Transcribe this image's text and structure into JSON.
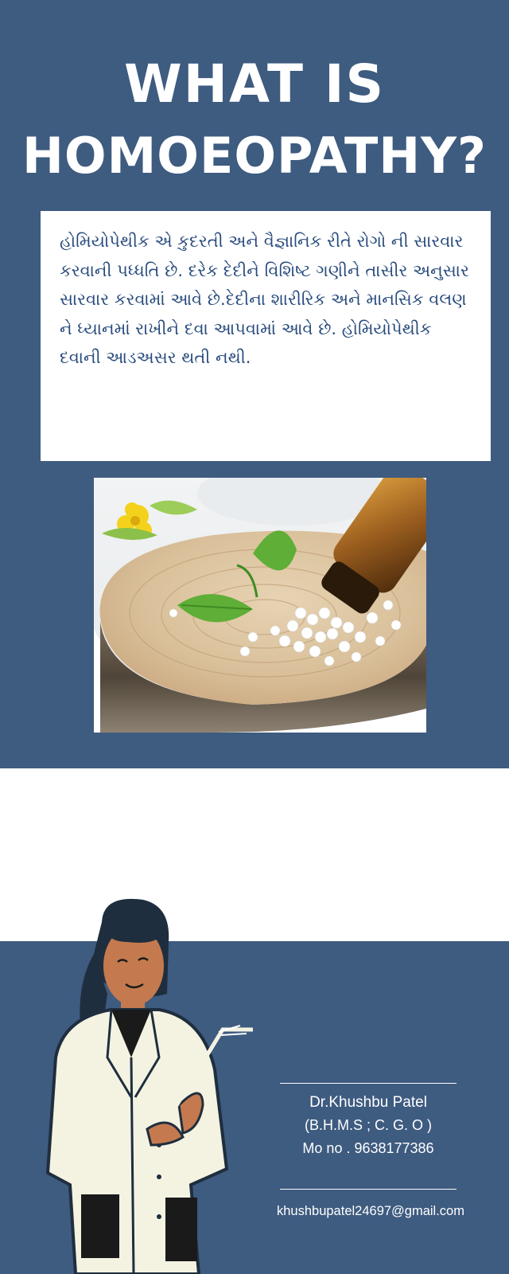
{
  "header": {
    "title_line1": "WHAT IS",
    "title_line2": "HOMOEOPATHY?"
  },
  "description": {
    "text": "હોમિયોપેથીક એ કુદરતી અને વૈજ્ઞાનિક રીતે રોગો ની સારવાર કરવાની પધ્ધતિ છે. દરેક દેદીને વિશિષ્ટ ગણીને તાસીર અનુસાર સારવાર કરવામાં આવે છે.દેદીના શારીરિક અને માનસિક વલણ ને ધ્યાનમાં રાખીને દવા આપવામાં આવે છે. હોમિયોપેથીક દવાની આડઅસર થતી નથી."
  },
  "contact": {
    "name": "Dr.Khushbu Patel",
    "qualifications": "(B.H.M.S ; C. G. O )",
    "phone": "Mo no . 9638177386",
    "email": "khushbupatel24697@gmail.com"
  },
  "colors": {
    "band": "#3e5b80",
    "card_text": "#274a7c",
    "white": "#ffffff"
  }
}
